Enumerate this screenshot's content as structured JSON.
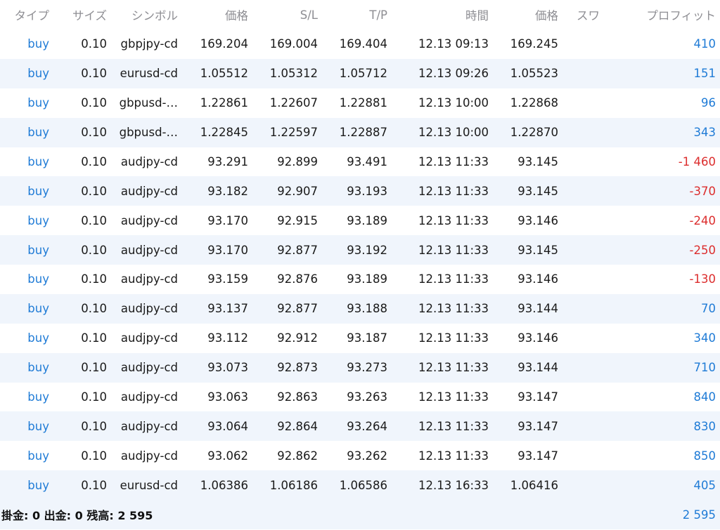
{
  "headers": {
    "type": "タイプ",
    "size": "サイズ",
    "symbol": "シンボル",
    "price": "価格",
    "sl": "S/L",
    "tp": "T/P",
    "time": "時間",
    "current": "価格",
    "swap": "スワ…",
    "profit": "プロフィット"
  },
  "rows": [
    {
      "type": "buy",
      "size": "0.10",
      "symbol": "gbpjpy-cd",
      "price": "169.204",
      "sl": "169.004",
      "tp": "169.404",
      "time": "12.13 09:13",
      "current": "169.245",
      "profit": "410"
    },
    {
      "type": "buy",
      "size": "0.10",
      "symbol": "eurusd-cd",
      "price": "1.05512",
      "sl": "1.05312",
      "tp": "1.05712",
      "time": "12.13 09:26",
      "current": "1.05523",
      "profit": "151"
    },
    {
      "type": "buy",
      "size": "0.10",
      "symbol": "gbpusd-…",
      "price": "1.22861",
      "sl": "1.22607",
      "tp": "1.22881",
      "time": "12.13 10:00",
      "current": "1.22868",
      "profit": "96"
    },
    {
      "type": "buy",
      "size": "0.10",
      "symbol": "gbpusd-…",
      "price": "1.22845",
      "sl": "1.22597",
      "tp": "1.22887",
      "time": "12.13 10:00",
      "current": "1.22870",
      "profit": "343"
    },
    {
      "type": "buy",
      "size": "0.10",
      "symbol": "audjpy-cd",
      "price": "93.291",
      "sl": "92.899",
      "tp": "93.491",
      "time": "12.13 11:33",
      "current": "93.145",
      "profit": "-1 460"
    },
    {
      "type": "buy",
      "size": "0.10",
      "symbol": "audjpy-cd",
      "price": "93.182",
      "sl": "92.907",
      "tp": "93.193",
      "time": "12.13 11:33",
      "current": "93.145",
      "profit": "-370"
    },
    {
      "type": "buy",
      "size": "0.10",
      "symbol": "audjpy-cd",
      "price": "93.170",
      "sl": "92.915",
      "tp": "93.189",
      "time": "12.13 11:33",
      "current": "93.146",
      "profit": "-240"
    },
    {
      "type": "buy",
      "size": "0.10",
      "symbol": "audjpy-cd",
      "price": "93.170",
      "sl": "92.877",
      "tp": "93.192",
      "time": "12.13 11:33",
      "current": "93.145",
      "profit": "-250"
    },
    {
      "type": "buy",
      "size": "0.10",
      "symbol": "audjpy-cd",
      "price": "93.159",
      "sl": "92.876",
      "tp": "93.189",
      "time": "12.13 11:33",
      "current": "93.146",
      "profit": "-130"
    },
    {
      "type": "buy",
      "size": "0.10",
      "symbol": "audjpy-cd",
      "price": "93.137",
      "sl": "92.877",
      "tp": "93.188",
      "time": "12.13 11:33",
      "current": "93.144",
      "profit": "70"
    },
    {
      "type": "buy",
      "size": "0.10",
      "symbol": "audjpy-cd",
      "price": "93.112",
      "sl": "92.912",
      "tp": "93.187",
      "time": "12.13 11:33",
      "current": "93.146",
      "profit": "340"
    },
    {
      "type": "buy",
      "size": "0.10",
      "symbol": "audjpy-cd",
      "price": "93.073",
      "sl": "92.873",
      "tp": "93.273",
      "time": "12.13 11:33",
      "current": "93.144",
      "profit": "710"
    },
    {
      "type": "buy",
      "size": "0.10",
      "symbol": "audjpy-cd",
      "price": "93.063",
      "sl": "92.863",
      "tp": "93.263",
      "time": "12.13 11:33",
      "current": "93.147",
      "profit": "840"
    },
    {
      "type": "buy",
      "size": "0.10",
      "symbol": "audjpy-cd",
      "price": "93.064",
      "sl": "92.864",
      "tp": "93.264",
      "time": "12.13 11:33",
      "current": "93.147",
      "profit": "830"
    },
    {
      "type": "buy",
      "size": "0.10",
      "symbol": "audjpy-cd",
      "price": "93.062",
      "sl": "92.862",
      "tp": "93.262",
      "time": "12.13 11:33",
      "current": "93.147",
      "profit": "850"
    },
    {
      "type": "buy",
      "size": "0.10",
      "symbol": "eurusd-cd",
      "price": "1.06386",
      "sl": "1.06186",
      "tp": "1.06586",
      "time": "12.13 16:33",
      "current": "1.06416",
      "profit": "405"
    }
  ],
  "footer": {
    "summary": "掛金: 0 出金: 0 残高: 2 595",
    "total_profit": "2 595"
  },
  "colors": {
    "accent_blue": "#1f7bd6",
    "loss_red": "#dc2d2d",
    "alt_row": "#f0f5fc"
  }
}
